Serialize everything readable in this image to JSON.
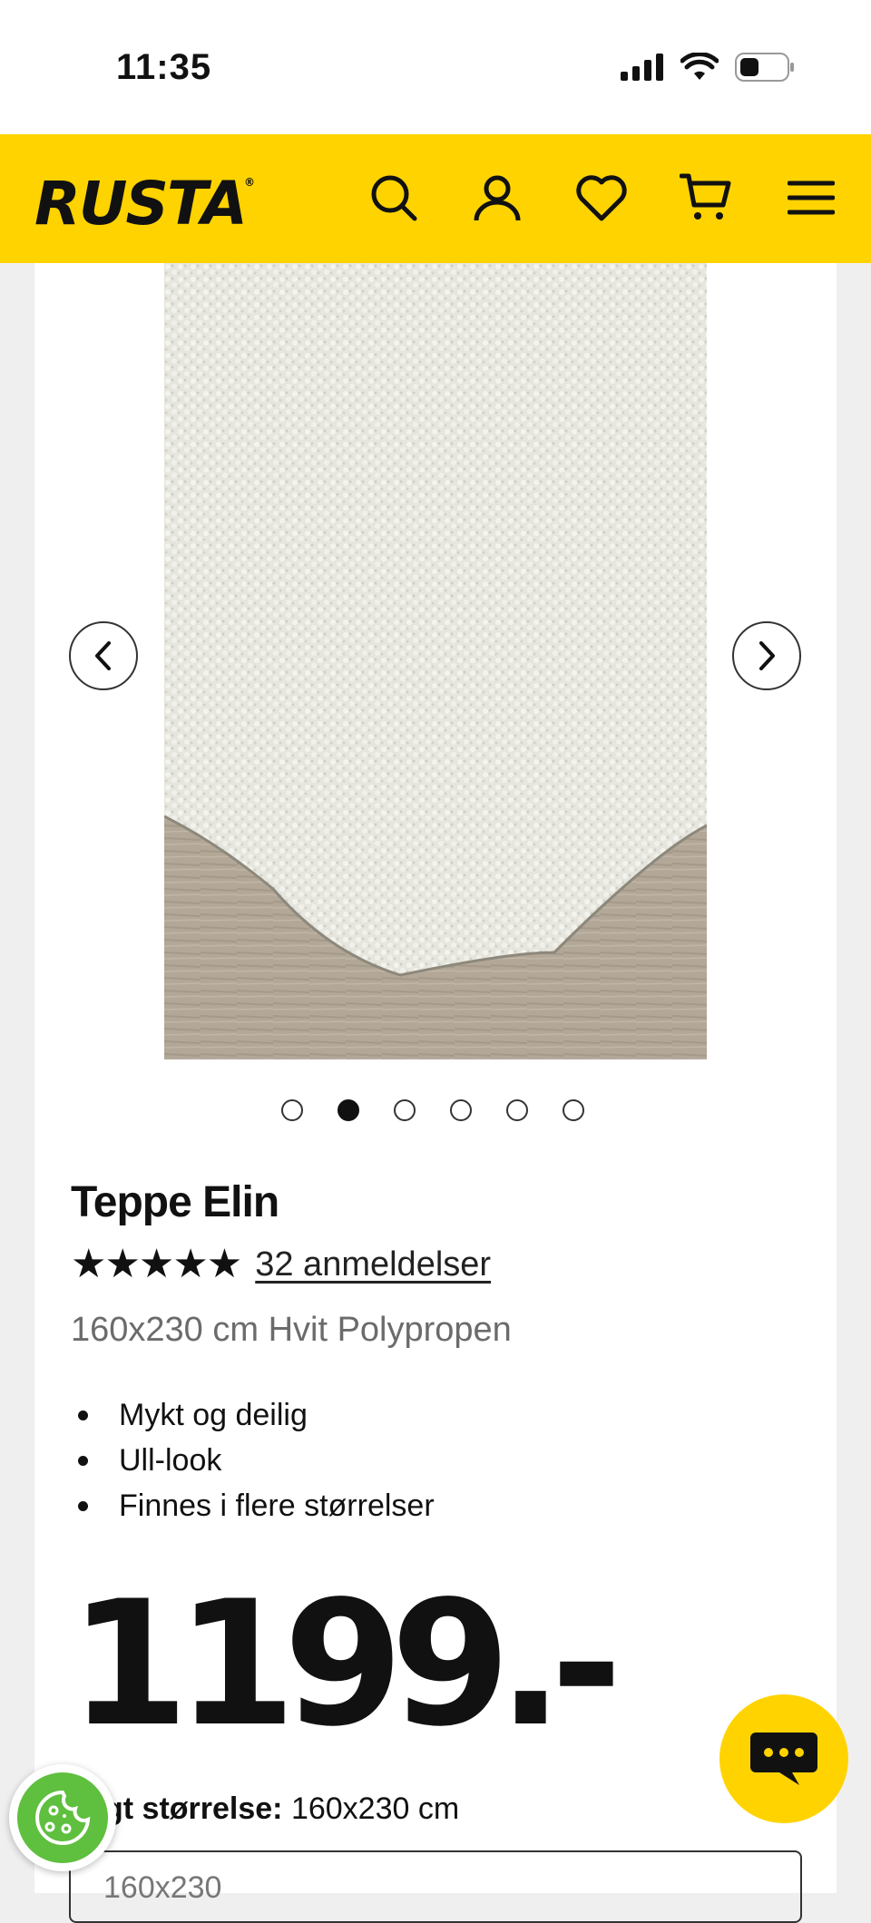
{
  "status_bar": {
    "time": "11:35"
  },
  "header": {
    "logo": "RUSTA",
    "logo_mark": "®"
  },
  "icons": {
    "search": "search-icon",
    "account": "user-icon",
    "wishlist": "heart-icon",
    "cart": "cart-icon",
    "menu": "hamburger-menu-icon",
    "chat": "chat-icon",
    "cookie": "cookie-icon"
  },
  "carousel": {
    "image_count": 6,
    "active_index": 1
  },
  "product": {
    "title": "Teppe Elin",
    "stars": "★★★★★",
    "rating": 5,
    "reviews": "32 anmeldelser",
    "subtitle": "160x230 cm Hvit Polypropen",
    "bullets": [
      "Mykt og deilig",
      "Ull-look",
      "Finnes i flere størrelser"
    ],
    "price": "1199.-",
    "size_label": "gt størrelse:",
    "size_value": "160x230 cm",
    "size_select_value": "160x230"
  },
  "colors": {
    "brand": "#ffd300",
    "cookie": "#5fbf3f"
  }
}
